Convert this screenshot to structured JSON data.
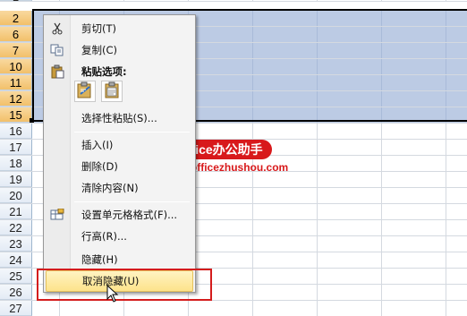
{
  "sheet": {
    "rows": [
      {
        "label": "2",
        "selected": true
      },
      {
        "label": "6",
        "selected": true
      },
      {
        "label": "7",
        "selected": true
      },
      {
        "label": "10",
        "selected": true
      },
      {
        "label": "11",
        "selected": true
      },
      {
        "label": "12",
        "selected": true
      },
      {
        "label": "15",
        "selected": true
      },
      {
        "label": "16",
        "selected": false
      },
      {
        "label": "17",
        "selected": false
      },
      {
        "label": "18",
        "selected": false
      },
      {
        "label": "19",
        "selected": false
      },
      {
        "label": "20",
        "selected": false
      },
      {
        "label": "21",
        "selected": false
      },
      {
        "label": "22",
        "selected": false
      },
      {
        "label": "23",
        "selected": false
      },
      {
        "label": "24",
        "selected": false
      },
      {
        "label": "25",
        "selected": false
      },
      {
        "label": "26",
        "selected": false
      },
      {
        "label": "27",
        "selected": false
      }
    ],
    "top_partial_row_label": "1",
    "selection_color": "#bccbe4",
    "header_selected_color": "#f2c06a"
  },
  "menu": {
    "items": [
      {
        "label": "剪切(T)",
        "icon": "scissors-icon"
      },
      {
        "label": "复制(C)",
        "icon": "copy-icon"
      },
      {
        "label": "粘贴选项:",
        "icon": "paste-icon"
      },
      {
        "label": "选择性粘贴(S)...",
        "icon": ""
      },
      {
        "label": "插入(I)",
        "icon": ""
      },
      {
        "label": "删除(D)",
        "icon": ""
      },
      {
        "label": "清除内容(N)",
        "icon": ""
      },
      {
        "label": "设置单元格格式(F)...",
        "icon": "format-cells-icon"
      },
      {
        "label": "行高(R)...",
        "icon": ""
      },
      {
        "label": "隐藏(H)",
        "icon": ""
      },
      {
        "label": "取消隐藏(U)",
        "icon": "",
        "highlighted": true
      }
    ],
    "paste_option_icons": [
      "paste-formula-icon",
      "paste-values-icon"
    ],
    "highlight_color": "#fde38b"
  },
  "watermark": {
    "badge": "Office办公助手",
    "url": "www.officezhushou.com",
    "color": "#d8191b"
  },
  "callout": {
    "color": "#d41c1c"
  }
}
